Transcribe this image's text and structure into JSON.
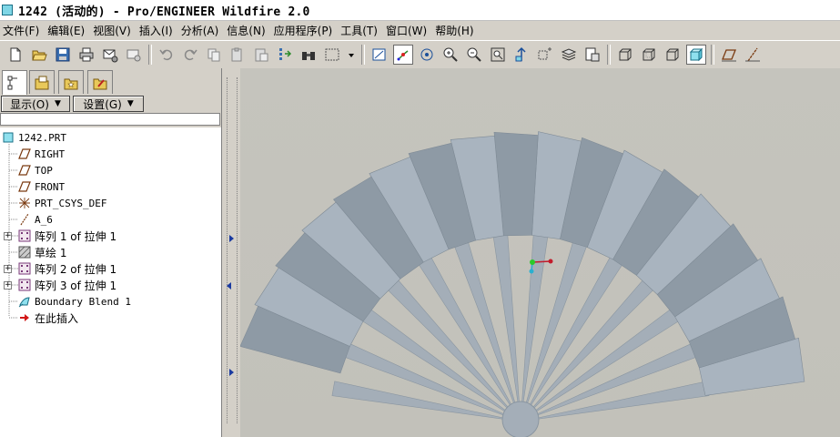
{
  "window": {
    "title": "1242 (活动的) - Pro/ENGINEER Wildfire 2.0"
  },
  "menubar": {
    "items": [
      {
        "label": "文件(F)"
      },
      {
        "label": "编辑(E)"
      },
      {
        "label": "视图(V)"
      },
      {
        "label": "插入(I)"
      },
      {
        "label": "分析(A)"
      },
      {
        "label": "信息(N)"
      },
      {
        "label": "应用程序(P)"
      },
      {
        "label": "工具(T)"
      },
      {
        "label": "窗口(W)"
      },
      {
        "label": "帮助(H)"
      }
    ]
  },
  "tree_controls": {
    "display_label": "显示(O)",
    "settings_label": "设置(G)"
  },
  "model_tree": {
    "root": "1242.PRT",
    "items": [
      {
        "label": "RIGHT",
        "icon": "datum-plane-icon"
      },
      {
        "label": "TOP",
        "icon": "datum-plane-icon"
      },
      {
        "label": "FRONT",
        "icon": "datum-plane-icon"
      },
      {
        "label": "PRT_CSYS_DEF",
        "icon": "coordinate-system-icon"
      },
      {
        "label": "A_6",
        "icon": "datum-axis-icon"
      },
      {
        "label": "阵列 1 of 拉伸 1",
        "icon": "pattern-icon",
        "expandable": true
      },
      {
        "label": "草绘 1",
        "icon": "sketch-icon"
      },
      {
        "label": "阵列 2 of 拉伸 1",
        "icon": "pattern-icon",
        "expandable": true
      },
      {
        "label": "阵列 3 of 拉伸 1",
        "icon": "pattern-icon",
        "expandable": true
      },
      {
        "label": "Boundary Blend 1",
        "icon": "boundary-blend-icon"
      },
      {
        "label": "在此插入",
        "icon": "insert-here-arrow-icon"
      }
    ]
  },
  "colors": {
    "fan_surface": "#a9b4bf",
    "fan_shadow": "#8e9aa5",
    "viewport_bg": "#c4c3bc",
    "panel_bg": "#d4d0c8"
  }
}
